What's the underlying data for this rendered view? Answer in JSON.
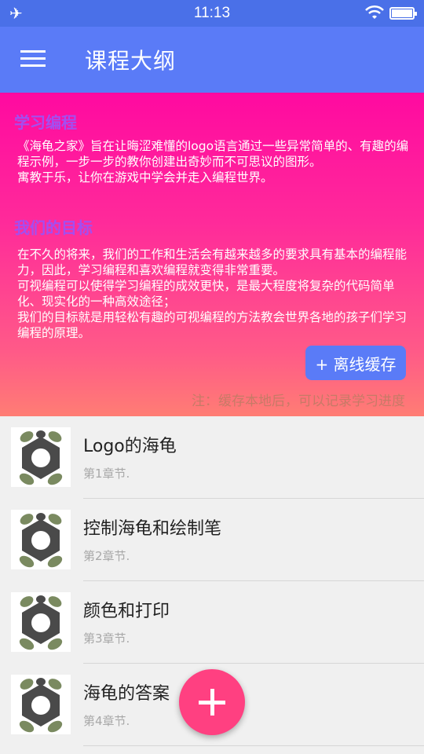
{
  "status_bar": {
    "time": "11:13",
    "airplane_icon": "airplane-icon",
    "wifi_icon": "wifi-icon",
    "battery_icon": "battery-icon"
  },
  "app_bar": {
    "title": "课程大纲",
    "menu_icon": "hamburger-menu-icon"
  },
  "hero": {
    "learn_heading": "学习编程",
    "learn_text": "《海龟之家》旨在让晦涩难懂的logo语言通过一些异常简单的、有趣的编程示例，一步一步的教你创建出奇妙而不可思议的图形。\n寓教于乐，让你在游戏中学会并走入编程世界。",
    "goal_heading": "我们的目标",
    "goal_text": "在不久的将来，我们的工作和生活会有越来越多的要求具有基本的编程能力，因此，学习编程和喜欢编程就变得非常重要。\n 可视编程可以使得学习编程的成效更快，是最大程度将复杂的代码简单化、现实化的一种高效途径；\n 我们的目标就是用轻松有趣的可视编程的方法教会世界各地的孩子们学习编程的原理。",
    "offline_button": "+ 离线缓存",
    "note": "注：缓存本地后，可以记录学习进度"
  },
  "chapters": [
    {
      "title": "Logo的海龟",
      "subtitle": "第1章节.",
      "icon": "turtle-logo-icon"
    },
    {
      "title": "控制海龟和绘制笔",
      "subtitle": "第2章节.",
      "icon": "turtle-logo-icon"
    },
    {
      "title": "颜色和打印",
      "subtitle": "第3章节.",
      "icon": "turtle-logo-icon"
    },
    {
      "title": "海龟的答案",
      "subtitle": "第4章节.",
      "icon": "turtle-logo-icon"
    }
  ],
  "fab": {
    "icon": "plus-icon"
  },
  "colors": {
    "primary": "#5a7bf7",
    "status_bar": "#4a70e8",
    "accent": "#ff4081",
    "heading": "#a44ef0"
  }
}
